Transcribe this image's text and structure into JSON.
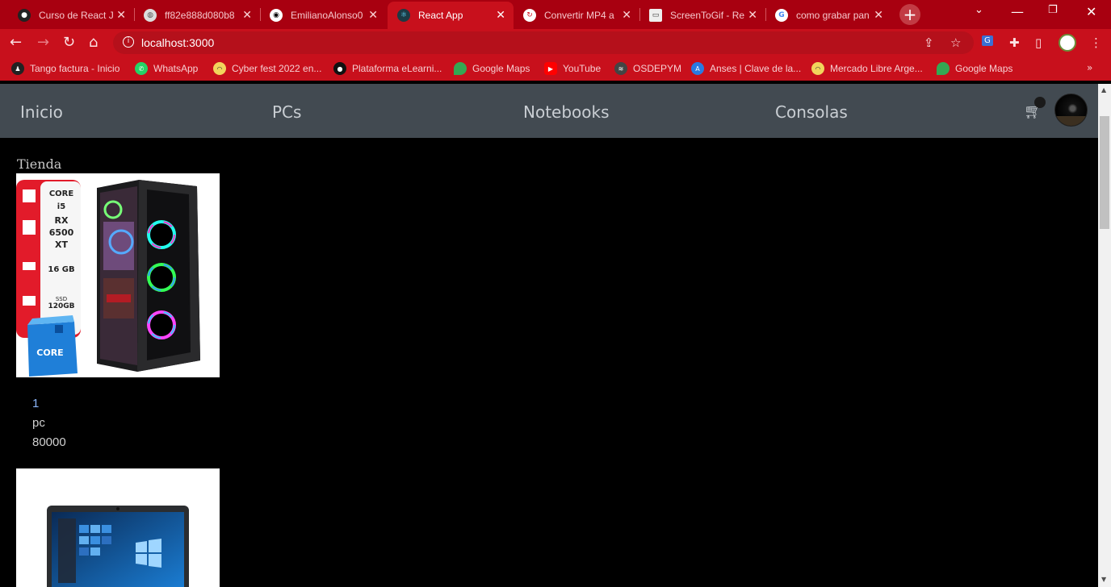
{
  "browser": {
    "tabs": [
      {
        "title": "Curso de React J",
        "icon": "coder-icon",
        "active": false
      },
      {
        "title": "ff82e888d080b8",
        "icon": "globe-icon",
        "active": false
      },
      {
        "title": "EmilianoAlonso0",
        "icon": "github-icon",
        "active": false
      },
      {
        "title": "React App",
        "icon": "react-icon",
        "active": true
      },
      {
        "title": "Convertir MP4 a",
        "icon": "convert-icon",
        "active": false
      },
      {
        "title": "ScreenToGif - Re",
        "icon": "screentogif-icon",
        "active": false
      },
      {
        "title": "como grabar pan",
        "icon": "google-icon",
        "active": false
      }
    ],
    "url": "localhost:3000",
    "bookmarks": [
      {
        "label": "Tango factura - Inicio"
      },
      {
        "label": "WhatsApp"
      },
      {
        "label": "Cyber fest 2022 en..."
      },
      {
        "label": "Plataforma eLearni..."
      },
      {
        "label": "Google Maps"
      },
      {
        "label": "YouTube"
      },
      {
        "label": "OSDEPYM"
      },
      {
        "label": "Anses | Clave de la..."
      },
      {
        "label": "Mercado Libre Arge..."
      },
      {
        "label": "Google Maps"
      }
    ]
  },
  "navbar": {
    "links": [
      "Inicio",
      "PCs",
      "Notebooks",
      "Consolas"
    ]
  },
  "store": {
    "title": "Tienda",
    "products": [
      {
        "id": "1",
        "category": "pc",
        "price": "80000",
        "image_text": {
          "cpu": "CORE i5",
          "gpu": "RX 6500 XT",
          "ram": "16 GB",
          "ssd": "SSD 120GB",
          "box": "CORE"
        }
      }
    ]
  },
  "colors": {
    "chrome_theme": "#c8101c",
    "tabbar": "#a80010",
    "navbar": "#424a51",
    "page_bg": "#000000"
  }
}
